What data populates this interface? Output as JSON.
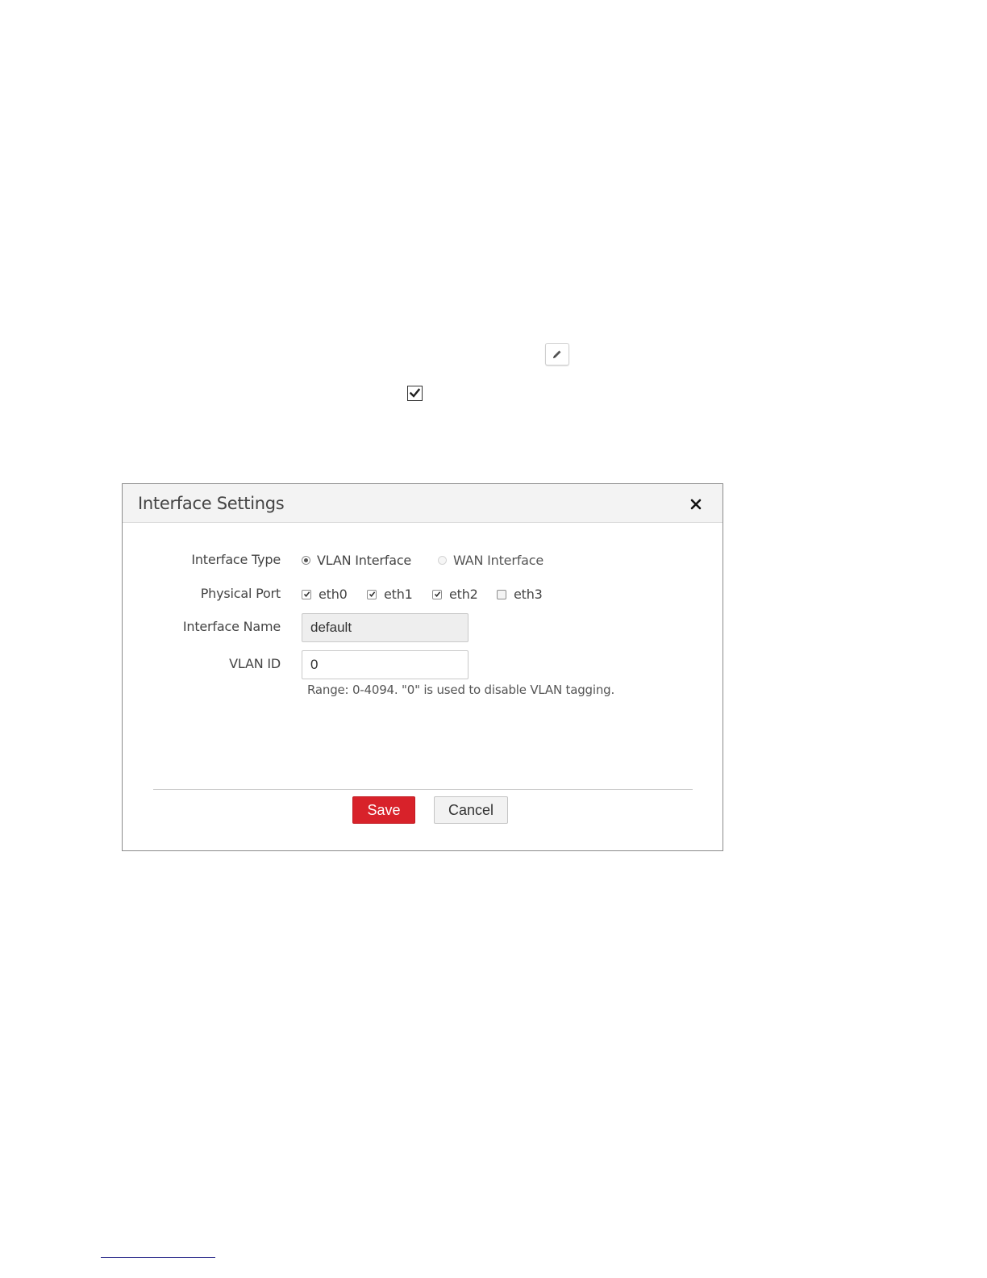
{
  "page": {
    "edit_icon": "pencil-icon",
    "checkbox_icon": "checkmark-icon"
  },
  "dialog": {
    "title": "Interface Settings",
    "close_icon": "close-icon",
    "interface_type": {
      "label": "Interface Type",
      "options": [
        {
          "label": "VLAN Interface",
          "selected": true,
          "enabled": true
        },
        {
          "label": "WAN Interface",
          "selected": false,
          "enabled": false
        }
      ]
    },
    "physical_port": {
      "label": "Physical Port",
      "ports": [
        {
          "label": "eth0",
          "checked": true
        },
        {
          "label": "eth1",
          "checked": true
        },
        {
          "label": "eth2",
          "checked": true
        },
        {
          "label": "eth3",
          "checked": false
        }
      ]
    },
    "interface_name": {
      "label": "Interface Name",
      "value": "default",
      "readonly": true
    },
    "vlan_id": {
      "label": "VLAN ID",
      "value": "0",
      "hint": "Range: 0-4094. \"0\" is used to disable VLAN tagging."
    },
    "buttons": {
      "save": "Save",
      "cancel": "Cancel"
    }
  },
  "colors": {
    "save_button": "#d8222a",
    "header_bg": "#f3f3f3",
    "readonly_bg": "#eeeeee"
  }
}
